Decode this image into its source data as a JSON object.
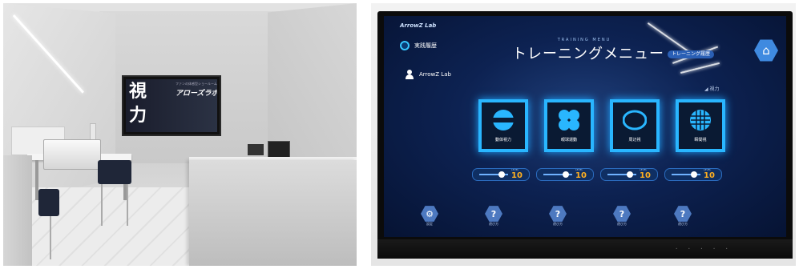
{
  "left_photo": {
    "tv": {
      "kanji_top": "視",
      "kanji_bottom": "力",
      "tagline": "ファンの体感型ショールーム",
      "brand": "アローズラボ"
    }
  },
  "right_photo": {
    "brand": "ArrowZ Lab",
    "menu_subtitle": "TRAINING MENU",
    "menu_title": "トレーニングメニュー",
    "side_items": [
      {
        "label": "実践履歴",
        "icon": "record-icon"
      },
      {
        "label": "ArrowZ Lab",
        "icon": "user-icon"
      }
    ],
    "history_button": "トレーニング履歴",
    "home_icon": "home-icon",
    "signal_label": "◢ 視力",
    "tiles": [
      {
        "label": "動体視力",
        "icon": "kinetic-vision-icon"
      },
      {
        "label": "眼球運動",
        "icon": "eye-movement-icon"
      },
      {
        "label": "周辺視",
        "icon": "peripheral-vision-icon"
      },
      {
        "label": "瞬間視",
        "icon": "instant-vision-icon"
      }
    ],
    "levels": [
      {
        "lv_label": "LEVEL",
        "value": "10"
      },
      {
        "lv_label": "LEVEL",
        "value": "10"
      },
      {
        "lv_label": "LEVEL",
        "value": "10"
      },
      {
        "lv_label": "LEVEL",
        "value": "10"
      }
    ],
    "bottom_buttons": [
      {
        "icon": "settings-icon",
        "label": "設定"
      },
      {
        "icon": "help-icon",
        "label": "遊び方"
      },
      {
        "icon": "help-icon",
        "label": "遊び方"
      },
      {
        "icon": "help-icon",
        "label": "遊び方"
      },
      {
        "icon": "help-icon",
        "label": "遊び方"
      }
    ]
  }
}
